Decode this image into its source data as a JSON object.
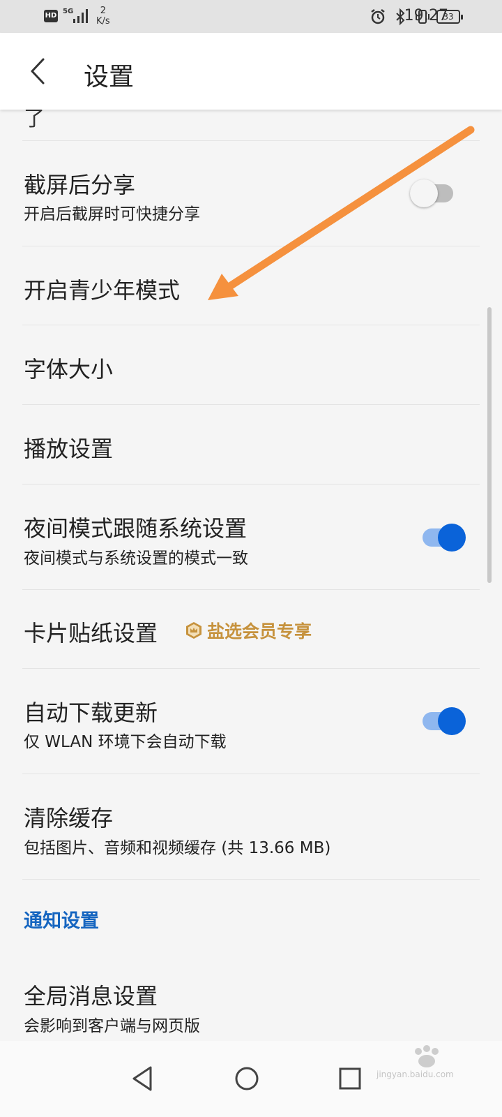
{
  "status_bar": {
    "hd": "HD",
    "network": "5G",
    "speed_value": "2",
    "speed_unit": "K/s",
    "battery": "33",
    "time": "19:27"
  },
  "header": {
    "title": "设置"
  },
  "settings": {
    "screenshot_share": {
      "title": "截屏后分享",
      "subtitle": "开启后截屏时可快捷分享",
      "enabled": false
    },
    "teen_mode": {
      "title": "开启青少年模式"
    },
    "font_size": {
      "title": "字体大小"
    },
    "playback": {
      "title": "播放设置"
    },
    "night_mode": {
      "title": "夜间模式跟随系统设置",
      "subtitle": "夜间模式与系统设置的模式一致",
      "enabled": true
    },
    "card_sticker": {
      "title": "卡片贴纸设置",
      "badge": "盐选会员专享"
    },
    "auto_update": {
      "title": "自动下载更新",
      "subtitle": "仅 WLAN 环境下会自动下载",
      "enabled": true
    },
    "clear_cache": {
      "title": "清除缓存",
      "subtitle": "包括图片、音频和视频缓存 (共 13.66 MB)"
    },
    "notification_section": {
      "title": "通知设置"
    },
    "global_message": {
      "title": "全局消息设置",
      "subtitle": "会影响到客户端与网页版"
    }
  },
  "watermark": {
    "text": "jingyan.baidu.com"
  },
  "colors": {
    "accent_blue": "#0a63d9",
    "section_blue": "#1565c0",
    "vip_gold": "#c6923d",
    "annotation_arrow": "#f5913e"
  }
}
